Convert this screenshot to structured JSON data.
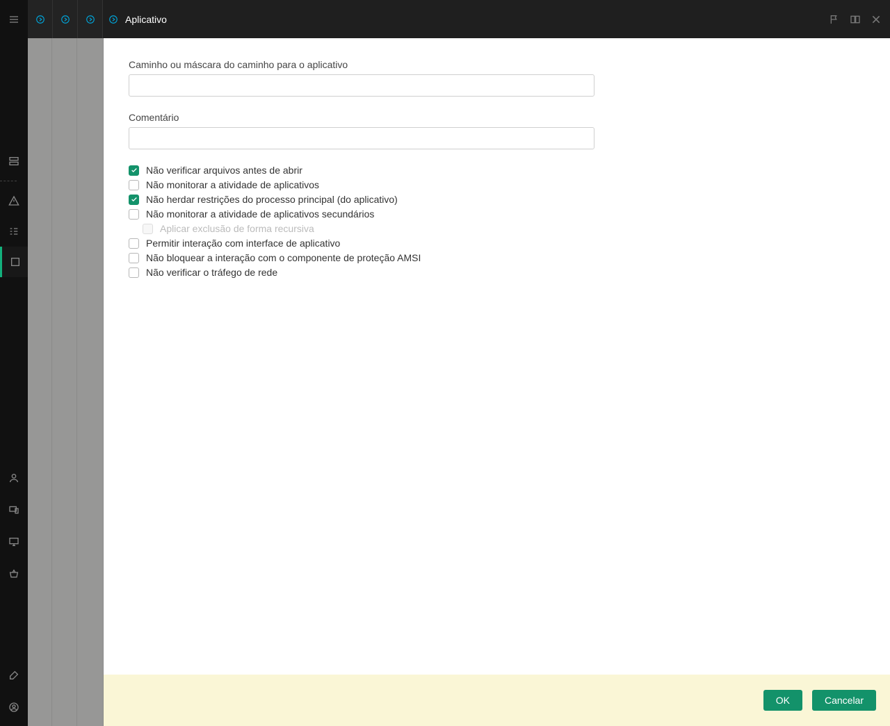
{
  "header": {
    "title": "Aplicativo"
  },
  "form": {
    "path_label": "Caminho ou máscara do caminho para o aplicativo",
    "path_value": "",
    "comment_label": "Comentário",
    "comment_value": ""
  },
  "checks": {
    "scan_before_open": {
      "label": "Não verificar arquivos antes de abrir",
      "checked": true
    },
    "monitor_activity": {
      "label": "Não monitorar a atividade de aplicativos",
      "checked": false
    },
    "inherit_restrictions": {
      "label": "Não herdar restrições do processo principal (do aplicativo)",
      "checked": true
    },
    "monitor_secondary": {
      "label": "Não monitorar a atividade de aplicativos secundários",
      "checked": false
    },
    "apply_recursive": {
      "label": "Aplicar exclusão de forma recursiva",
      "checked": false,
      "disabled": true
    },
    "allow_ui_interaction": {
      "label": "Permitir interação com interface de aplicativo",
      "checked": false
    },
    "amsi": {
      "label": "Não bloquear a interação com o componente de proteção AMSI",
      "checked": false
    },
    "network_traffic": {
      "label": "Não verificar o tráfego de rede",
      "checked": false
    }
  },
  "buttons": {
    "ok": "OK",
    "cancel": "Cancelar"
  }
}
